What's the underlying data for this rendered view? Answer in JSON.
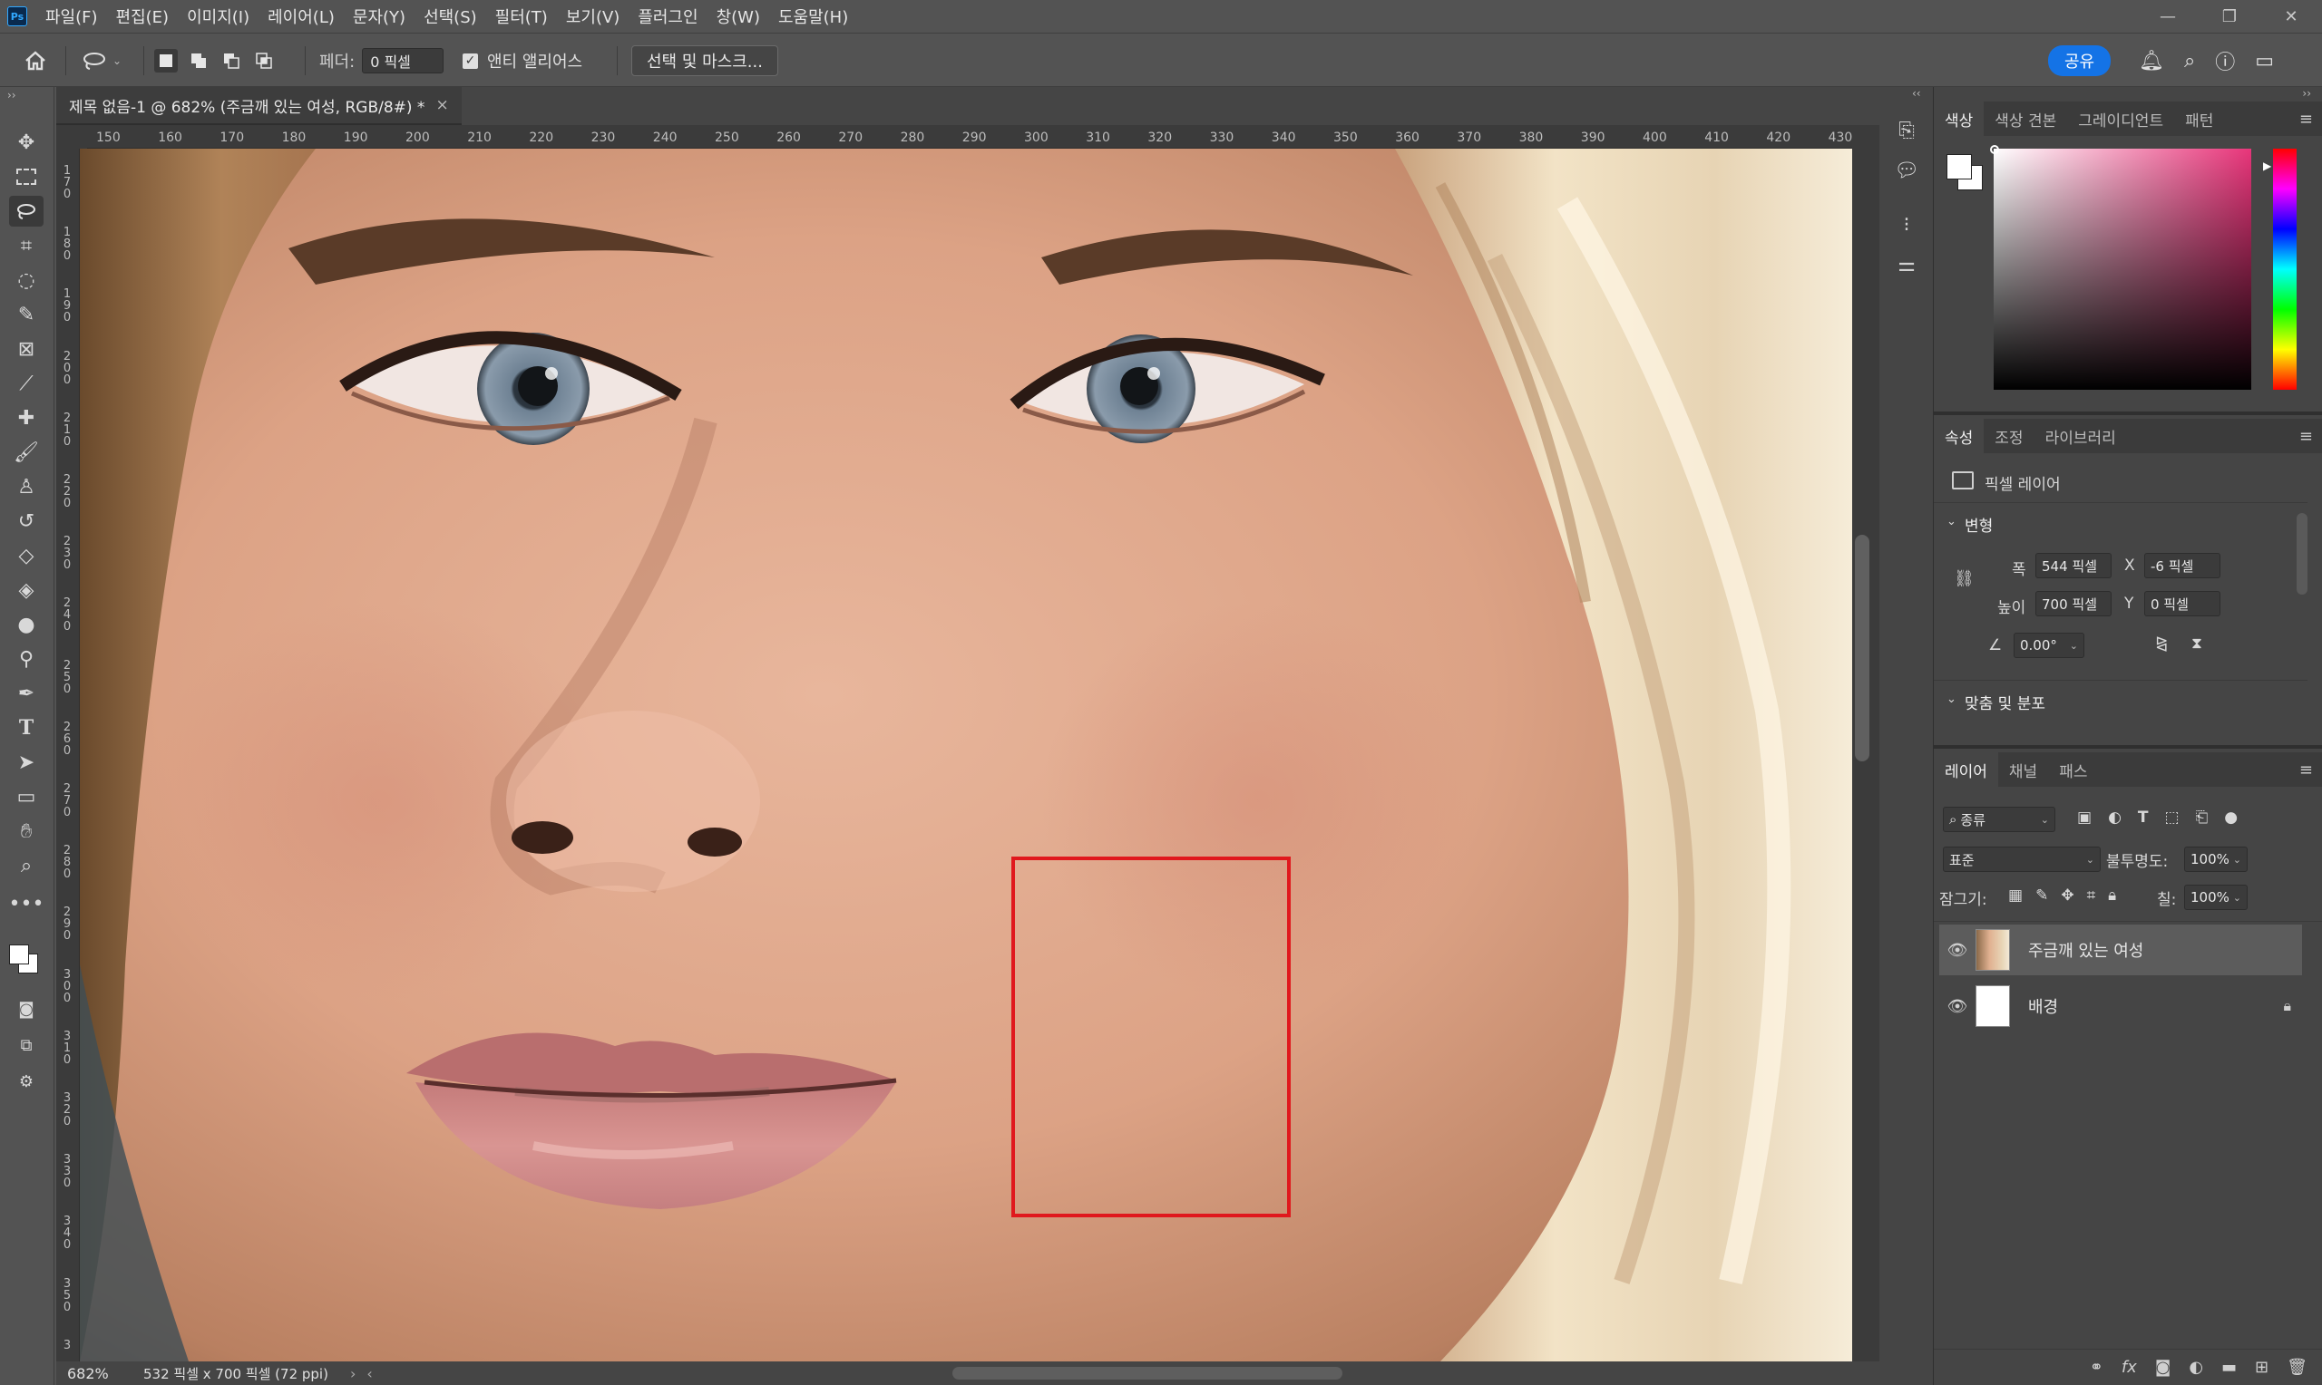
{
  "app": {
    "logo": "Ps"
  },
  "menu": [
    "파일(F)",
    "편집(E)",
    "이미지(I)",
    "레이어(L)",
    "문자(Y)",
    "선택(S)",
    "필터(T)",
    "보기(V)",
    "플러그인",
    "창(W)",
    "도움말(H)"
  ],
  "window_controls": {
    "minimize": "—",
    "restore": "❐",
    "close": "✕"
  },
  "options": {
    "feather_label": "페더:",
    "feather_value": "0 픽셀",
    "antialias_label": "앤티 앨리어스",
    "antialias_checked": true,
    "select_mask_label": "선택 및 마스크...",
    "share_label": "공유"
  },
  "document": {
    "tab_title": "제목 없음-1 @ 682% (주금깨 있는 여성, RGB/8#) *",
    "close": "×",
    "zoom": "682%",
    "size_info": "532 픽셀 x 700 픽셀 (72 ppi)"
  },
  "ruler": {
    "h_ticks": [
      "150",
      "160",
      "170",
      "180",
      "190",
      "200",
      "210",
      "220",
      "230",
      "240",
      "250",
      "260",
      "270",
      "280",
      "290",
      "300",
      "310",
      "320",
      "330",
      "340",
      "350",
      "360",
      "370",
      "380",
      "390",
      "400",
      "410",
      "420",
      "430"
    ],
    "v_ticks": [
      "170",
      "180",
      "190",
      "200",
      "210",
      "220",
      "230",
      "240",
      "250",
      "260",
      "270",
      "280",
      "290",
      "300",
      "310",
      "320",
      "330",
      "340",
      "350",
      "3"
    ]
  },
  "color_panel": {
    "tabs": [
      "색상",
      "색상 견본",
      "그레이디언트",
      "패턴"
    ],
    "active": 0,
    "hue_color": "#e8357a"
  },
  "properties_panel": {
    "tabs": [
      "속성",
      "조정",
      "라이브러리"
    ],
    "active": 0,
    "layer_type": "픽셀 레이어",
    "transform_section": "변형",
    "width_label": "폭",
    "width_value": "544 픽셀",
    "x_label": "X",
    "x_value": "-6 픽셀",
    "height_label": "높이",
    "height_value": "700 픽셀",
    "y_label": "Y",
    "y_value": "0 픽셀",
    "angle_value": "0.00°",
    "align_section": "맞춤 및 분포"
  },
  "layers_panel": {
    "tabs": [
      "레이어",
      "채널",
      "패스"
    ],
    "active": 0,
    "filter_kind": "종류",
    "blend_mode": "표준",
    "opacity_label": "불투명도:",
    "opacity_value": "100%",
    "lock_label": "잠그기:",
    "fill_label": "칠:",
    "fill_value": "100%",
    "layers": [
      {
        "name": "주금깨 있는 여성",
        "selected": true,
        "locked": false
      },
      {
        "name": "배경",
        "selected": false,
        "locked": true
      }
    ]
  }
}
